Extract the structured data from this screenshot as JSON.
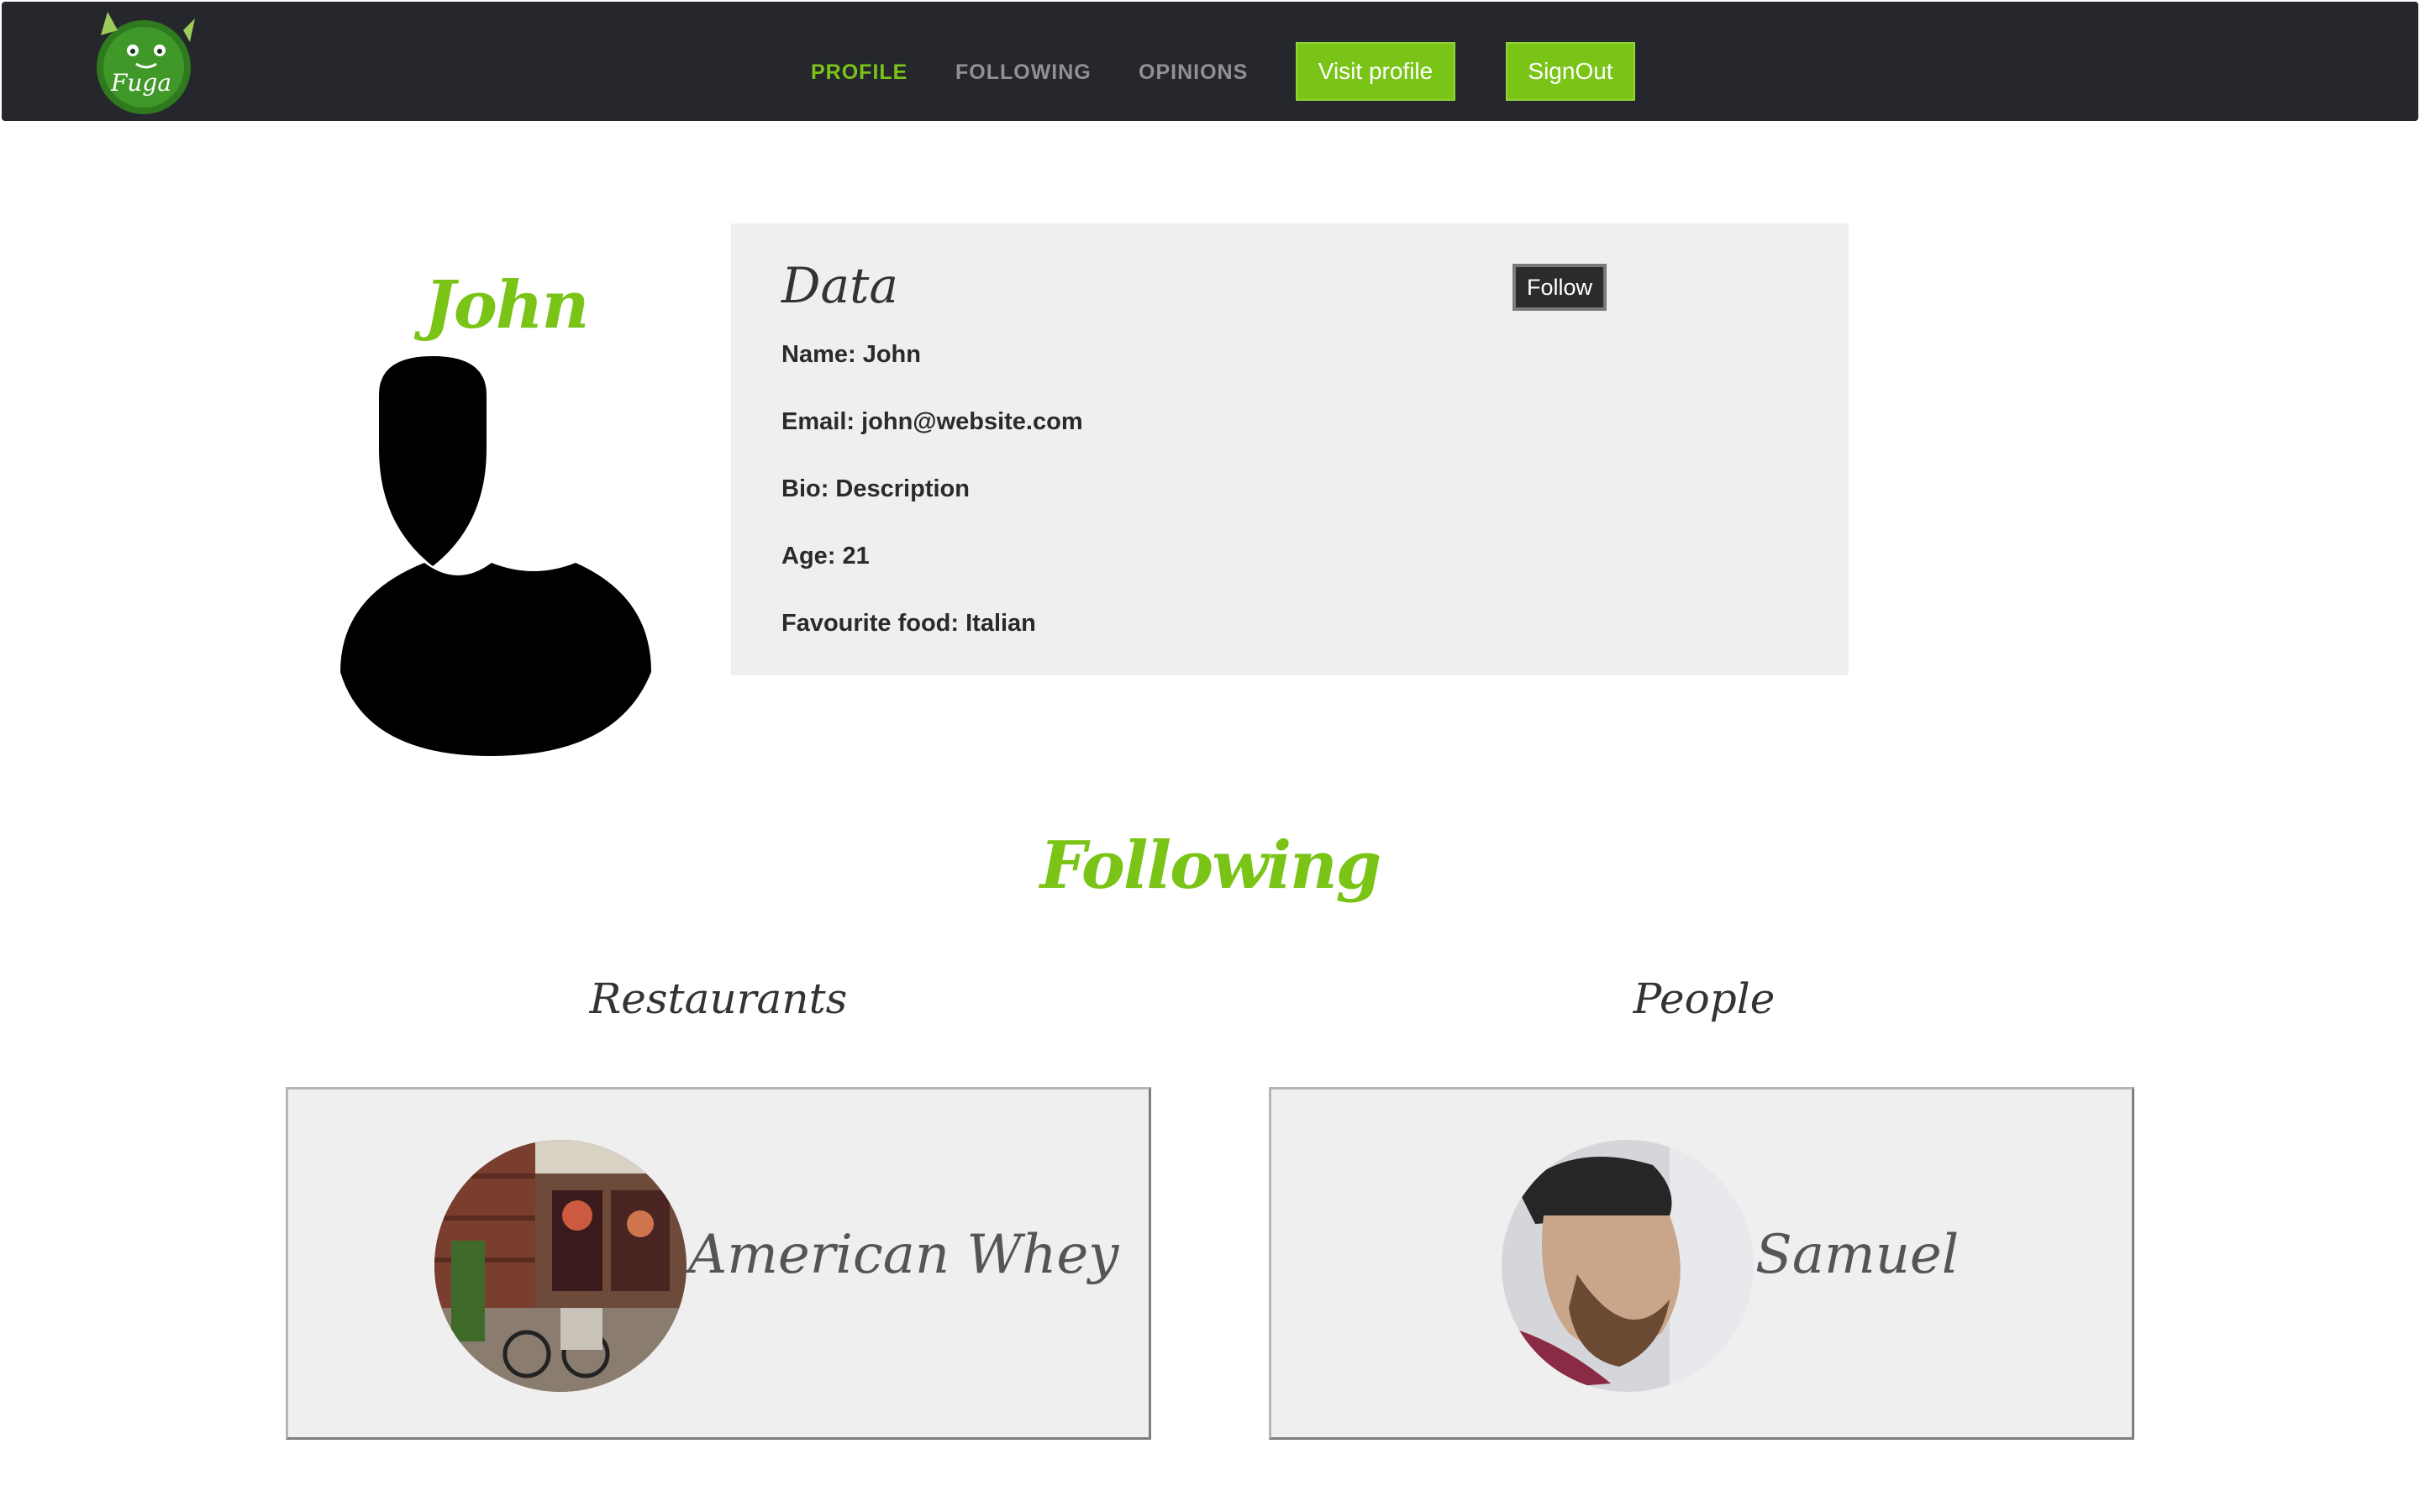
{
  "nav": {
    "links": [
      "PROFILE",
      "FOLLOWING",
      "OPINIONS"
    ],
    "visit_profile": "Visit profile",
    "sign_out": "SignOut",
    "logo_text": "Fuga"
  },
  "profile": {
    "name": "John",
    "data_title": "Data",
    "follow_label": "Follow",
    "fields": [
      "Name: John",
      "Email: john@website.com",
      "Bio: Description",
      "Age: 21",
      "Favourite food: Italian"
    ]
  },
  "following": {
    "title": "Following",
    "restaurants_heading": "Restaurants",
    "people_heading": "People",
    "restaurant_card_name": "American Whey",
    "person_card_name": "Samuel"
  },
  "colors": {
    "accent": "#7ac417",
    "navbar": "#25272c",
    "panel": "#efefef",
    "nav_inactive": "#8f9194"
  },
  "icons": {
    "logo": "fuga-logo-icon",
    "avatar": "user-silhouette-icon"
  }
}
